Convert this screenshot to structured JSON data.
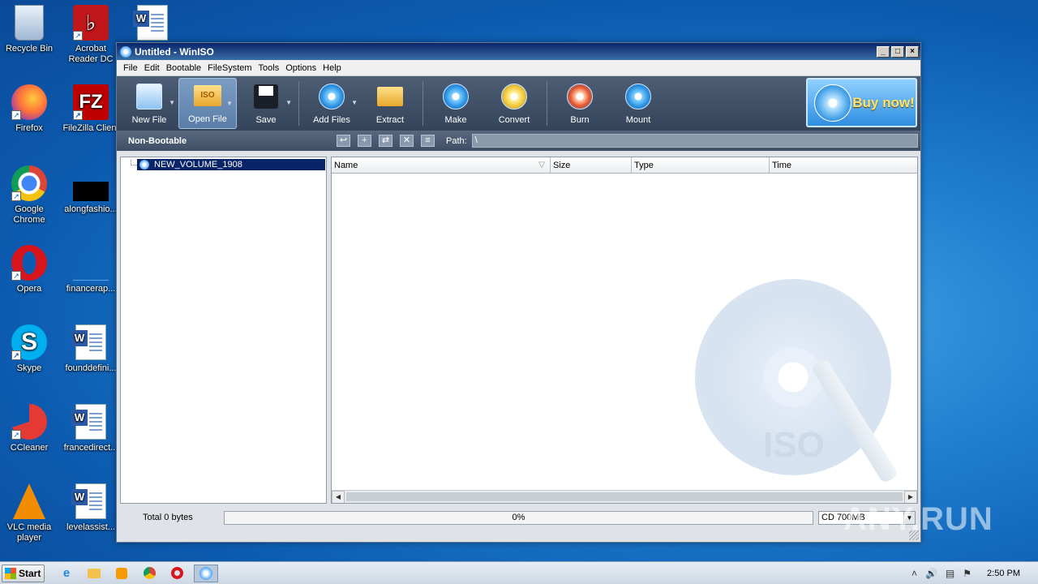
{
  "desktop": {
    "icons": [
      {
        "label": "Recycle Bin"
      },
      {
        "label": "Acrobat Reader DC"
      },
      {
        "label": "Firefox"
      },
      {
        "label": "FileZilla Client"
      },
      {
        "label": "Google Chrome"
      },
      {
        "label": "alongfashio..."
      },
      {
        "label": "Opera"
      },
      {
        "label": "financerap..."
      },
      {
        "label": "Skype"
      },
      {
        "label": "founddefini..."
      },
      {
        "label": "CCleaner"
      },
      {
        "label": "francedirect..."
      },
      {
        "label": "VLC media player"
      },
      {
        "label": "levelassist..."
      }
    ]
  },
  "window": {
    "title": "Untitled - WinISO",
    "menu": [
      "File",
      "Edit",
      "Bootable",
      "FileSystem",
      "Tools",
      "Options",
      "Help"
    ],
    "toolbar": [
      {
        "label": "New File",
        "icon": "new-file-icon"
      },
      {
        "label": "Open File",
        "icon": "open-file-icon"
      },
      {
        "label": "Save",
        "icon": "save-icon"
      },
      {
        "label": "Add Files",
        "icon": "add-files-icon"
      },
      {
        "label": "Extract",
        "icon": "extract-icon"
      },
      {
        "label": "Make",
        "icon": "make-icon"
      },
      {
        "label": "Convert",
        "icon": "convert-icon"
      },
      {
        "label": "Burn",
        "icon": "burn-icon"
      },
      {
        "label": "Mount",
        "icon": "mount-icon"
      }
    ],
    "buy_now": "Buy now!",
    "boot_status": "Non-Bootable",
    "path_label": "Path:",
    "path_value": "\\",
    "tree_root": "NEW_VOLUME_1908",
    "columns": [
      "Name",
      "Size",
      "Type",
      "Time"
    ],
    "watermark_text": "ISO",
    "total": "Total 0 bytes",
    "progress": "0%",
    "progress_value": 0,
    "media": "CD 700MB"
  },
  "taskbar": {
    "start": "Start",
    "clock": "2:50 PM"
  },
  "overlay": "ANY.RUN"
}
